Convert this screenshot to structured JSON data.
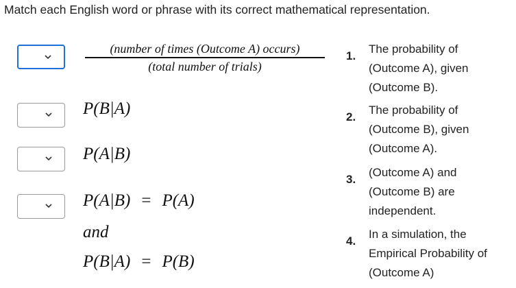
{
  "question": "Match each English word or phrase with its correct mathematical representation.",
  "left_items": [
    {
      "numerator": "(number of times (Outcome A) occurs)",
      "denominator": "(total number of trials)"
    },
    {
      "expr": "P(B|A)"
    },
    {
      "expr": "P(A|B)"
    },
    {
      "line1": "P(A|B)",
      "eq": "=",
      "rhs1": "P(A)",
      "and": "and",
      "line3": "P(B|A)",
      "rhs3": "P(B)"
    }
  ],
  "options": [
    {
      "number": "1.",
      "text": "The probability of (Outcome A), given (Outcome B)."
    },
    {
      "number": "2.",
      "text": "The probability of (Outcome B), given (Outcome A)."
    },
    {
      "number": "3.",
      "text": "(Outcome A) and (Outcome B) are independent."
    },
    {
      "number": "4.",
      "text": "In a simulation, the Empirical Probability of (Outcome A)"
    }
  ],
  "accent_color": "#1e6fd9"
}
